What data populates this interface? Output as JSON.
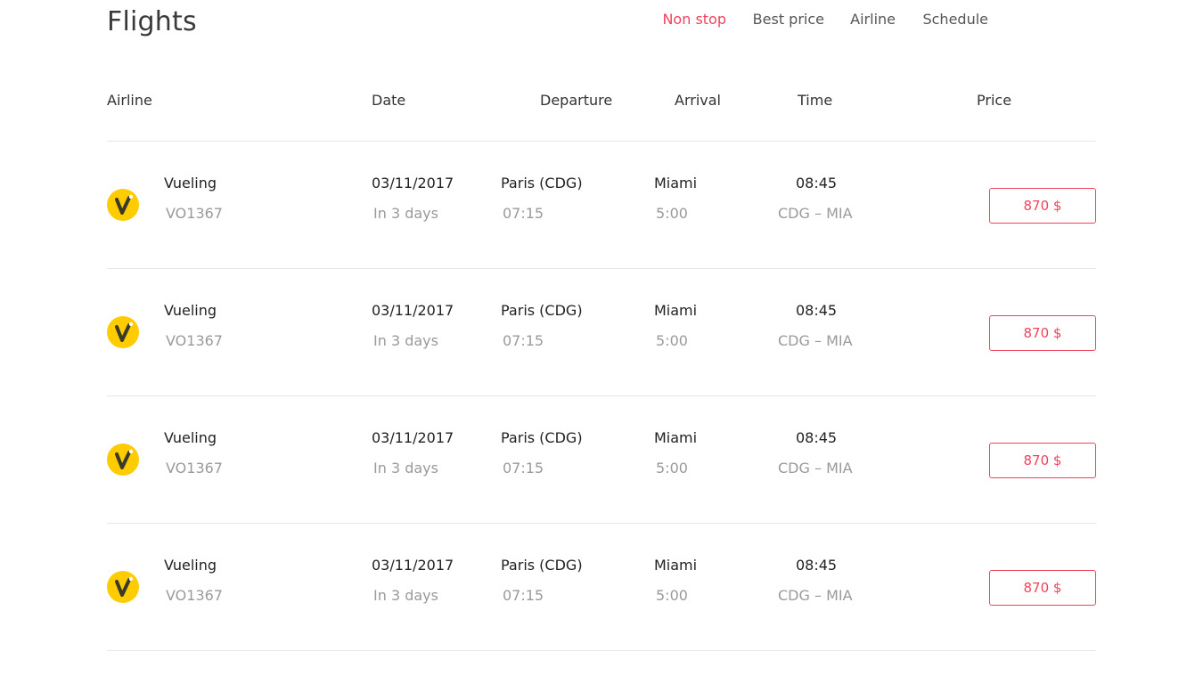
{
  "header": {
    "title": "Flights",
    "filters": [
      {
        "label": "Non stop",
        "active": true
      },
      {
        "label": "Best price",
        "active": false
      },
      {
        "label": "Airline",
        "active": false
      },
      {
        "label": "Schedule",
        "active": false
      }
    ]
  },
  "columns": {
    "airline": "Airline",
    "date": "Date",
    "departure": "Departure",
    "arrival": "Arrival",
    "time": "Time",
    "price": "Price"
  },
  "colors": {
    "accent": "#f0435b",
    "logo": "#ffcc00"
  },
  "flights": [
    {
      "airline": "Vueling",
      "flight_no": "VO1367",
      "logo_icon": "vueling-logo-icon",
      "date": "03/11/2017",
      "relative": "In 3 days",
      "from": "Paris (CDG)",
      "dep_time": "07:15",
      "to": "Miami",
      "duration": "5:00",
      "arr_time": "08:45",
      "route": "CDG – MIA",
      "price": "870 $"
    },
    {
      "airline": "Vueling",
      "flight_no": "VO1367",
      "logo_icon": "vueling-logo-icon",
      "date": "03/11/2017",
      "relative": "In 3 days",
      "from": "Paris (CDG)",
      "dep_time": "07:15",
      "to": "Miami",
      "duration": "5:00",
      "arr_time": "08:45",
      "route": "CDG – MIA",
      "price": "870 $"
    },
    {
      "airline": "Vueling",
      "flight_no": "VO1367",
      "logo_icon": "vueling-logo-icon",
      "date": "03/11/2017",
      "relative": "In 3 days",
      "from": "Paris (CDG)",
      "dep_time": "07:15",
      "to": "Miami",
      "duration": "5:00",
      "arr_time": "08:45",
      "route": "CDG – MIA",
      "price": "870 $"
    },
    {
      "airline": "Vueling",
      "flight_no": "VO1367",
      "logo_icon": "vueling-logo-icon",
      "date": "03/11/2017",
      "relative": "In 3 days",
      "from": "Paris (CDG)",
      "dep_time": "07:15",
      "to": "Miami",
      "duration": "5:00",
      "arr_time": "08:45",
      "route": "CDG – MIA",
      "price": "870 $"
    }
  ]
}
